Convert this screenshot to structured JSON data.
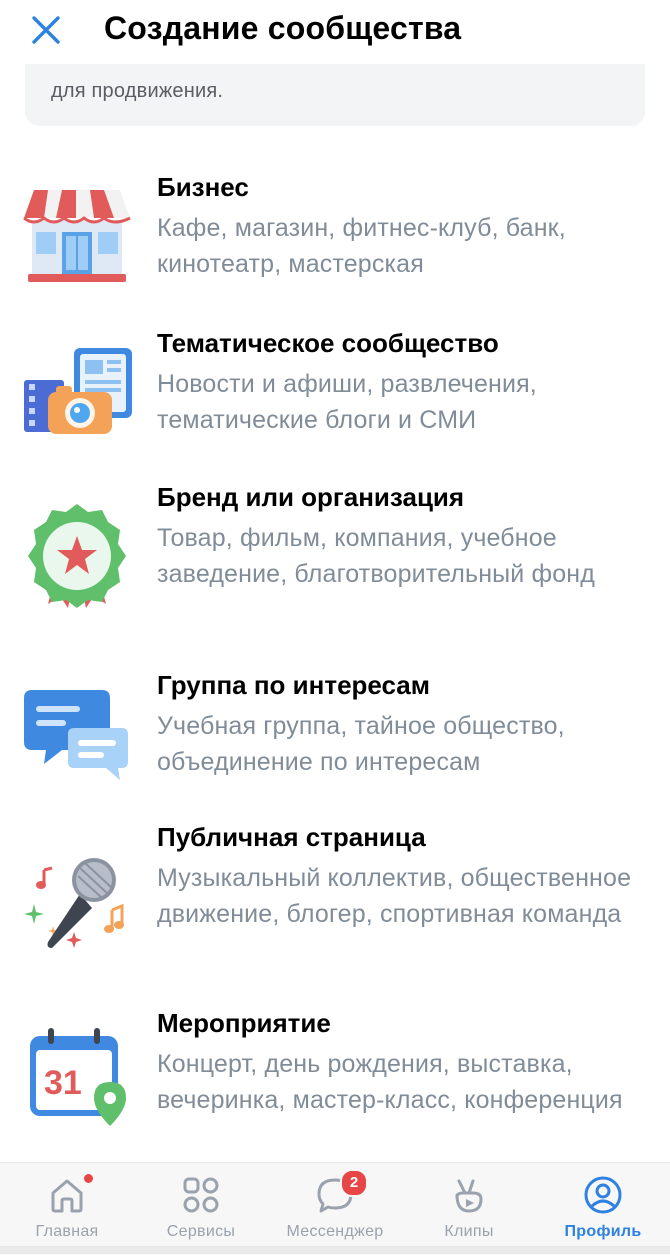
{
  "header": {
    "title": "Создание сообщества"
  },
  "info_card": {
    "text": "для продвижения."
  },
  "categories": [
    {
      "name": "Бизнес",
      "description": "Кафе, магазин, фитнес-клуб, банк, кинотеатр, мастерская",
      "icon": "shop-icon"
    },
    {
      "name": "Тематическое сообщество",
      "description": "Новости и афиши, развлечения, тематические блоги и СМИ",
      "icon": "media-icon"
    },
    {
      "name": "Бренд или организация",
      "description": "Товар, фильм, компания, учебное заведение, благотворительный фонд",
      "icon": "award-icon"
    },
    {
      "name": "Группа по интересам",
      "description": "Учебная группа, тайное общество, объединение по интересам",
      "icon": "chat-icon"
    },
    {
      "name": "Публичная страница",
      "description": "Музыкальный коллектив, общественное движение, блогер, спортивная команда",
      "icon": "microphone-icon"
    },
    {
      "name": "Мероприятие",
      "description": "Концерт, день рождения, выставка, вечеринка, мастер-класс, конференция",
      "icon": "calendar-icon",
      "calendar_day": "31"
    }
  ],
  "tabbar": {
    "tabs": [
      {
        "label": "Главная",
        "icon": "home-icon"
      },
      {
        "label": "Сервисы",
        "icon": "services-icon"
      },
      {
        "label": "Мессенджер",
        "icon": "messenger-icon",
        "badge": "2"
      },
      {
        "label": "Клипы",
        "icon": "clips-icon"
      },
      {
        "label": "Профиль",
        "icon": "profile-icon",
        "active": true
      }
    ]
  },
  "colors": {
    "accent": "#2d81e0",
    "badge": "#e64646",
    "secondary_text": "#818c99"
  }
}
